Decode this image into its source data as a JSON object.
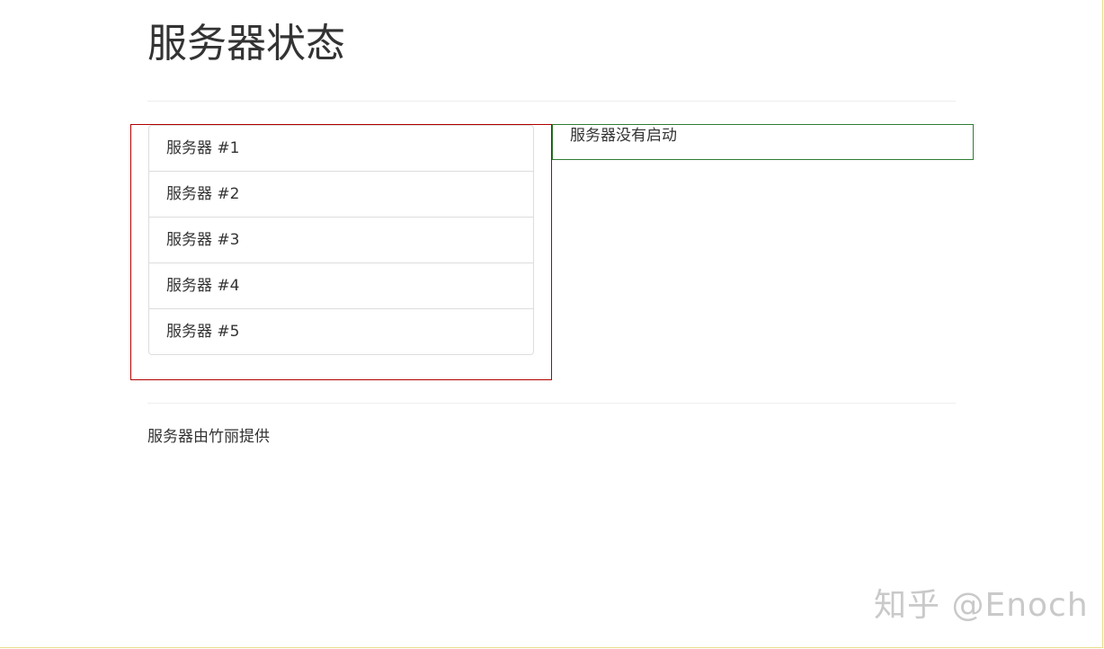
{
  "page": {
    "title": "服务器状态"
  },
  "servers": [
    {
      "label": "服务器 #1"
    },
    {
      "label": "服务器 #2"
    },
    {
      "label": "服务器 #3"
    },
    {
      "label": "服务器 #4"
    },
    {
      "label": "服务器 #5"
    }
  ],
  "status": {
    "message": "服务器没有启动"
  },
  "footer": {
    "text": "服务器由竹丽提供"
  },
  "watermark": {
    "text": "知乎 @Enoch"
  },
  "colors": {
    "list_outline": "#b00000",
    "status_outline": "#2e7d32",
    "divider": "#eeeeee",
    "text": "#333333"
  }
}
